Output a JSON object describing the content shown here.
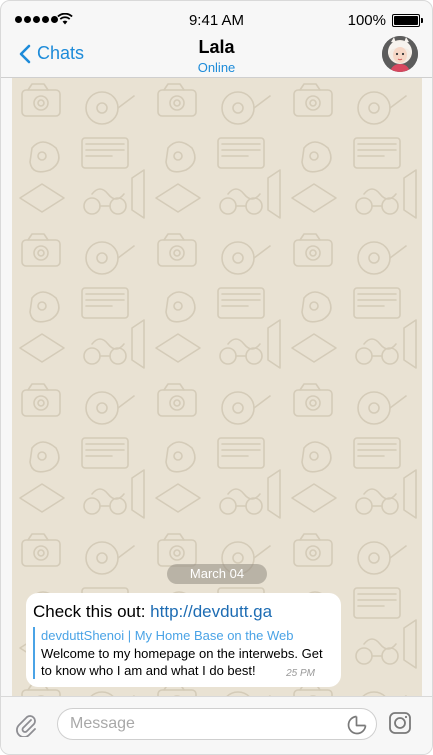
{
  "status_bar": {
    "time": "9:41 AM",
    "battery": "100%"
  },
  "nav": {
    "back_label": "Chats",
    "title": "Lala",
    "status": "Online"
  },
  "chat": {
    "date_label": "March 04",
    "message": {
      "prefix": "Check this out: ",
      "link": "http://devdutt.ga",
      "preview_title": "devduttShenoi | My Home Base on the Web",
      "preview_description": "Welcome to my homepage on the interwebs. Get to know who I am and what I do best!",
      "time": "25 PM"
    }
  },
  "input": {
    "placeholder": "Message"
  },
  "colors": {
    "accent": "#1d8bd9",
    "wallpaper": "#e9e2d3",
    "link": "#1d6cb3"
  }
}
